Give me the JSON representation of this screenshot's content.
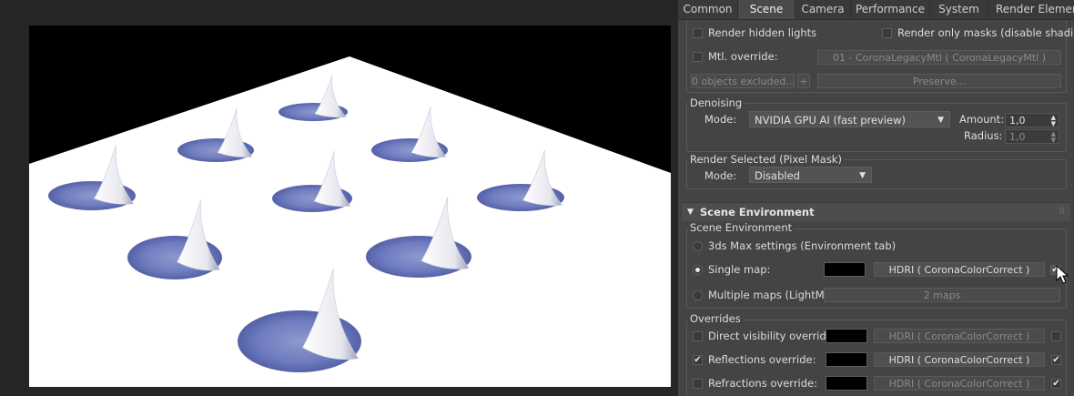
{
  "tabs": [
    "Common",
    "Scene",
    "Camera",
    "Performance",
    "System",
    "Render Elements"
  ],
  "active_tab": "Scene",
  "general": {
    "render_hidden_lights": "Render hidden lights",
    "render_only_masks": "Render only masks (disable shading",
    "mtl_override": "Mtl. override:",
    "mtl_override_value": "01 - CoronaLegacyMtl  ( CoronaLegacyMtl )",
    "objects_excluded": "0 objects excluded...",
    "plus": "+",
    "preserve": "Preserve..."
  },
  "denoising": {
    "title": "Denoising",
    "mode_label": "Mode:",
    "mode_value": "NVIDIA GPU AI (fast preview)",
    "amount_label": "Amount:",
    "amount_value": "1,0",
    "radius_label": "Radius:",
    "radius_value": "1,0"
  },
  "render_selected": {
    "title": "Render Selected (Pixel Mask)",
    "mode_label": "Mode:",
    "mode_value": "Disabled"
  },
  "scene_environment": {
    "rollout_title": "Scene Environment",
    "group_title": "Scene Environment",
    "opt_3ds": "3ds Max settings (Environment tab)",
    "opt_single": "Single map:",
    "single_map_value": "HDRI  ( CoronaColorCorrect )",
    "opt_multiple": "Multiple maps (LightMix):",
    "multiple_value": "2 maps",
    "selected_option": "single"
  },
  "overrides": {
    "title": "Overrides",
    "direct_visibility": "Direct visibility override:",
    "direct_visibility_value": "HDRI  ( CoronaColorCorrect )",
    "reflections": "Reflections override:",
    "reflections_value": "HDRI  ( CoronaColorCorrect )",
    "refractions": "Refractions override:",
    "refractions_value": "HDRI  ( CoronaColorCorrect )"
  },
  "colors": {
    "panel_bg": "#444444",
    "render_bg": "#000000",
    "plane": "#ffffff",
    "shadow": "#5a68b0"
  },
  "icons": {
    "check": "✔",
    "dropdown": "▼",
    "rollout_open": "▼",
    "spinner": "▲▼",
    "grip": "⠿"
  }
}
